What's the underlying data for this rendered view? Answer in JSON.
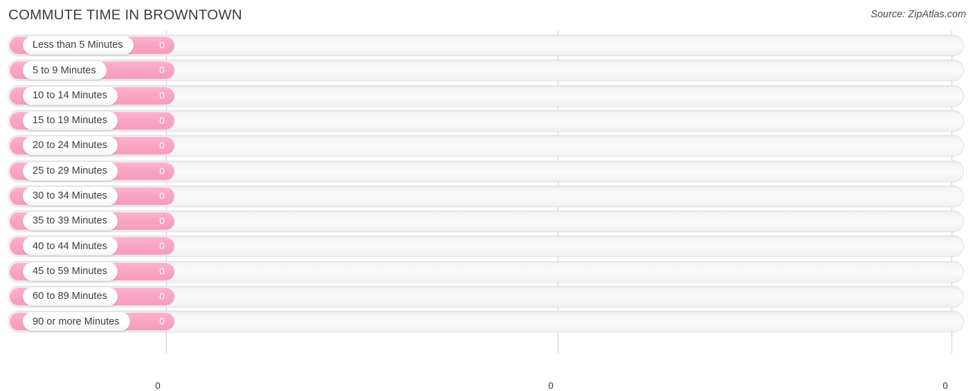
{
  "header": {
    "title": "COMMUTE TIME IN BROWNTOWN",
    "source": "Source: ZipAtlas.com"
  },
  "colors": {
    "bar": "#f9a5c5",
    "track": "#f7f7f7",
    "gridline": "#cfcfcf",
    "label_text": "#3c3c43",
    "value_text": "#ffffff"
  },
  "chart_data": {
    "type": "bar",
    "orientation": "horizontal",
    "title": "COMMUTE TIME IN BROWNTOWN",
    "xlabel": "",
    "ylabel": "",
    "grid": true,
    "legend": null,
    "xlim": [
      0,
      0
    ],
    "xticks": [
      "0",
      "0",
      "0"
    ],
    "categories": [
      "Less than 5 Minutes",
      "5 to 9 Minutes",
      "10 to 14 Minutes",
      "15 to 19 Minutes",
      "20 to 24 Minutes",
      "25 to 29 Minutes",
      "30 to 34 Minutes",
      "35 to 39 Minutes",
      "40 to 44 Minutes",
      "45 to 59 Minutes",
      "60 to 89 Minutes",
      "90 or more Minutes"
    ],
    "values": [
      0,
      0,
      0,
      0,
      0,
      0,
      0,
      0,
      0,
      0,
      0,
      0
    ],
    "value_labels": [
      "0",
      "0",
      "0",
      "0",
      "0",
      "0",
      "0",
      "0",
      "0",
      "0",
      "0",
      "0"
    ]
  }
}
